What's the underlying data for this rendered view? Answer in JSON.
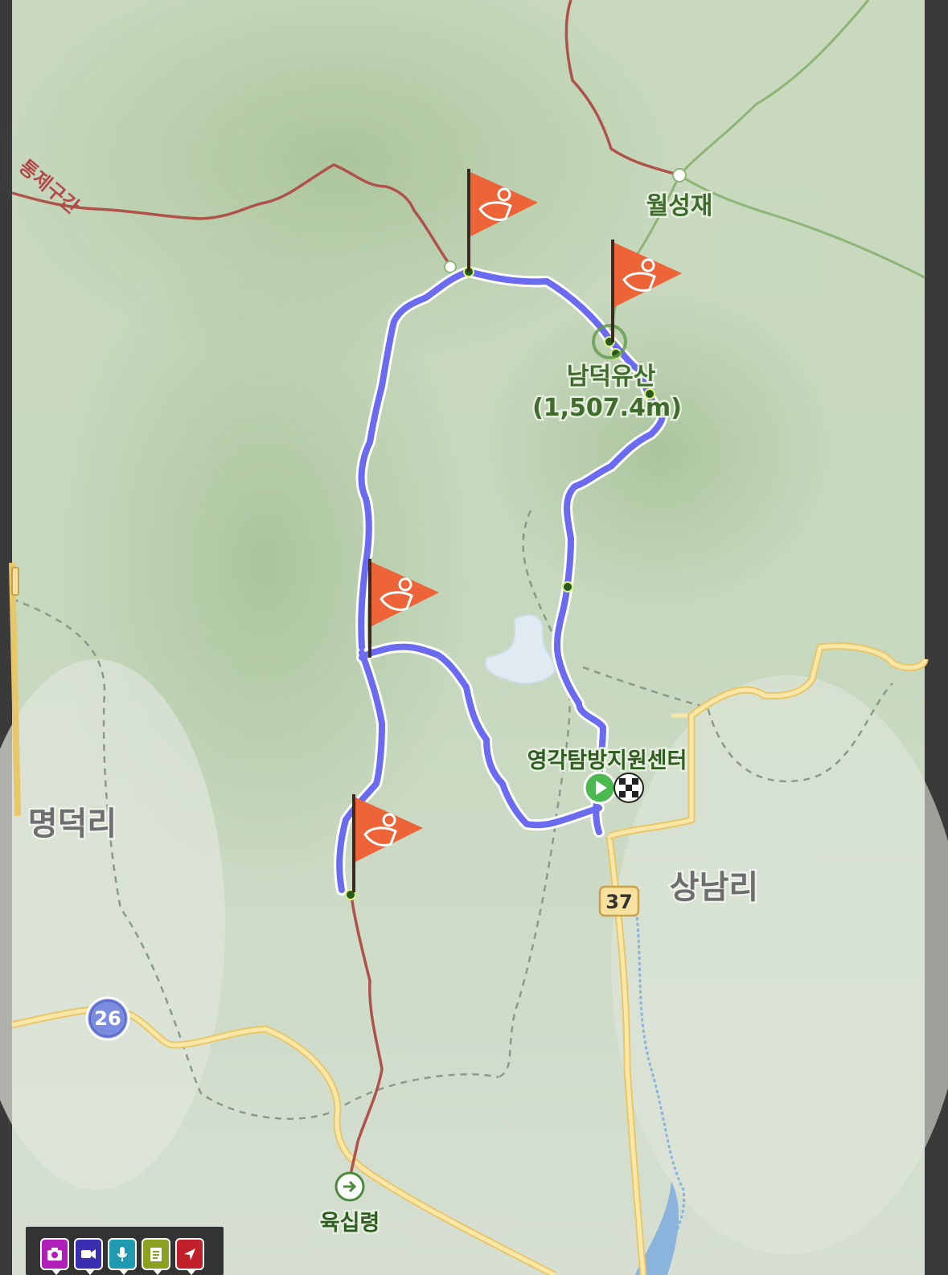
{
  "map": {
    "labels": {
      "restricted_section": "통제구간",
      "wolseongjae": "월성재",
      "namdeokyusan": "남덕유산",
      "namdeokyusan_elev": "(1,507.4m)",
      "yeonggak_center": "영각탐방지원센터",
      "myeongdeok_ri": "명덕리",
      "sangnam_ri": "상남리",
      "yuksimnyeong": "육십령"
    },
    "road_numbers": {
      "route_37": "37",
      "route_26": "26"
    },
    "colors": {
      "track": "#6b6bf2",
      "trail": "#b0524c",
      "flag": "#e8553a",
      "road": "#f5dc8c"
    },
    "markers": {
      "flag_count": 4,
      "start_icon": "start-play-icon",
      "finish_icon": "finish-checkered-icon"
    }
  },
  "toolbar": {
    "buttons": [
      {
        "name": "camera-icon",
        "color": "#b020b8"
      },
      {
        "name": "video-icon",
        "color": "#3a2fb0"
      },
      {
        "name": "microphone-icon",
        "color": "#1f9ab0"
      },
      {
        "name": "memo-icon",
        "color": "#8aa020"
      },
      {
        "name": "location-icon",
        "color": "#c0202a"
      }
    ]
  }
}
